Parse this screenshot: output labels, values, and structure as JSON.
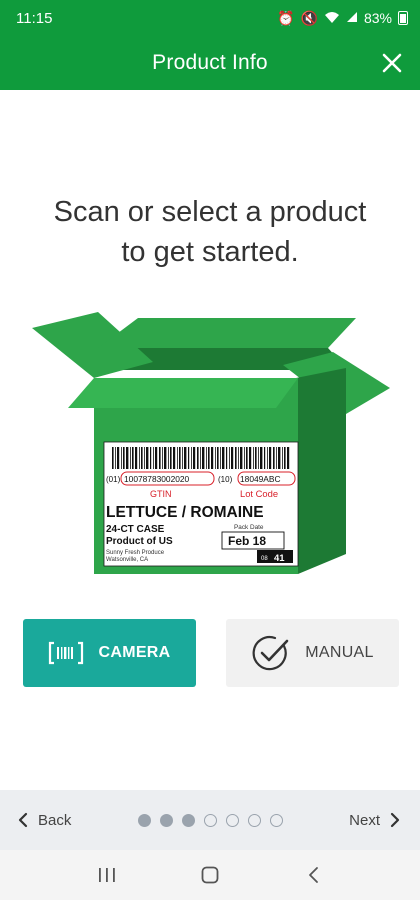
{
  "status_bar": {
    "time": "11:15",
    "battery": "83%"
  },
  "app_bar": {
    "title": "Product Info"
  },
  "prompt": {
    "line1": "Scan or select a product",
    "line2": "to get started."
  },
  "label": {
    "gtin_prefix": "(01)",
    "gtin_value": "10078783002020",
    "lot_prefix": "(10)",
    "lot_value": "18049ABC",
    "gtin_caption": "GTIN",
    "lot_caption": "Lot Code",
    "product_name": "LETTUCE / ROMAINE",
    "case_text": "24-CT CASE",
    "origin": "Product of US",
    "company": "Sunny Fresh Produce",
    "location": "Watsonville, CA",
    "pack_date_caption": "Pack Date",
    "pack_date": "Feb 18",
    "qty_prefix": "08",
    "qty_value": "41"
  },
  "actions": {
    "camera_label": "CAMERA",
    "manual_label": "MANUAL"
  },
  "pager": {
    "back_label": "Back",
    "next_label": "Next",
    "total_steps": 7,
    "filled_steps": 3
  },
  "colors": {
    "brand_green": "#0f9b3c",
    "camera_teal": "#1aa99b",
    "box_green": "#2ea54a",
    "box_dark": "#1d7a34",
    "lot_red": "#d8202a"
  },
  "icons": {
    "close": "close-icon",
    "camera": "barcode-scan-icon",
    "manual": "checkmark-circle-icon",
    "back": "chevron-left-icon",
    "next": "chevron-right-icon"
  }
}
